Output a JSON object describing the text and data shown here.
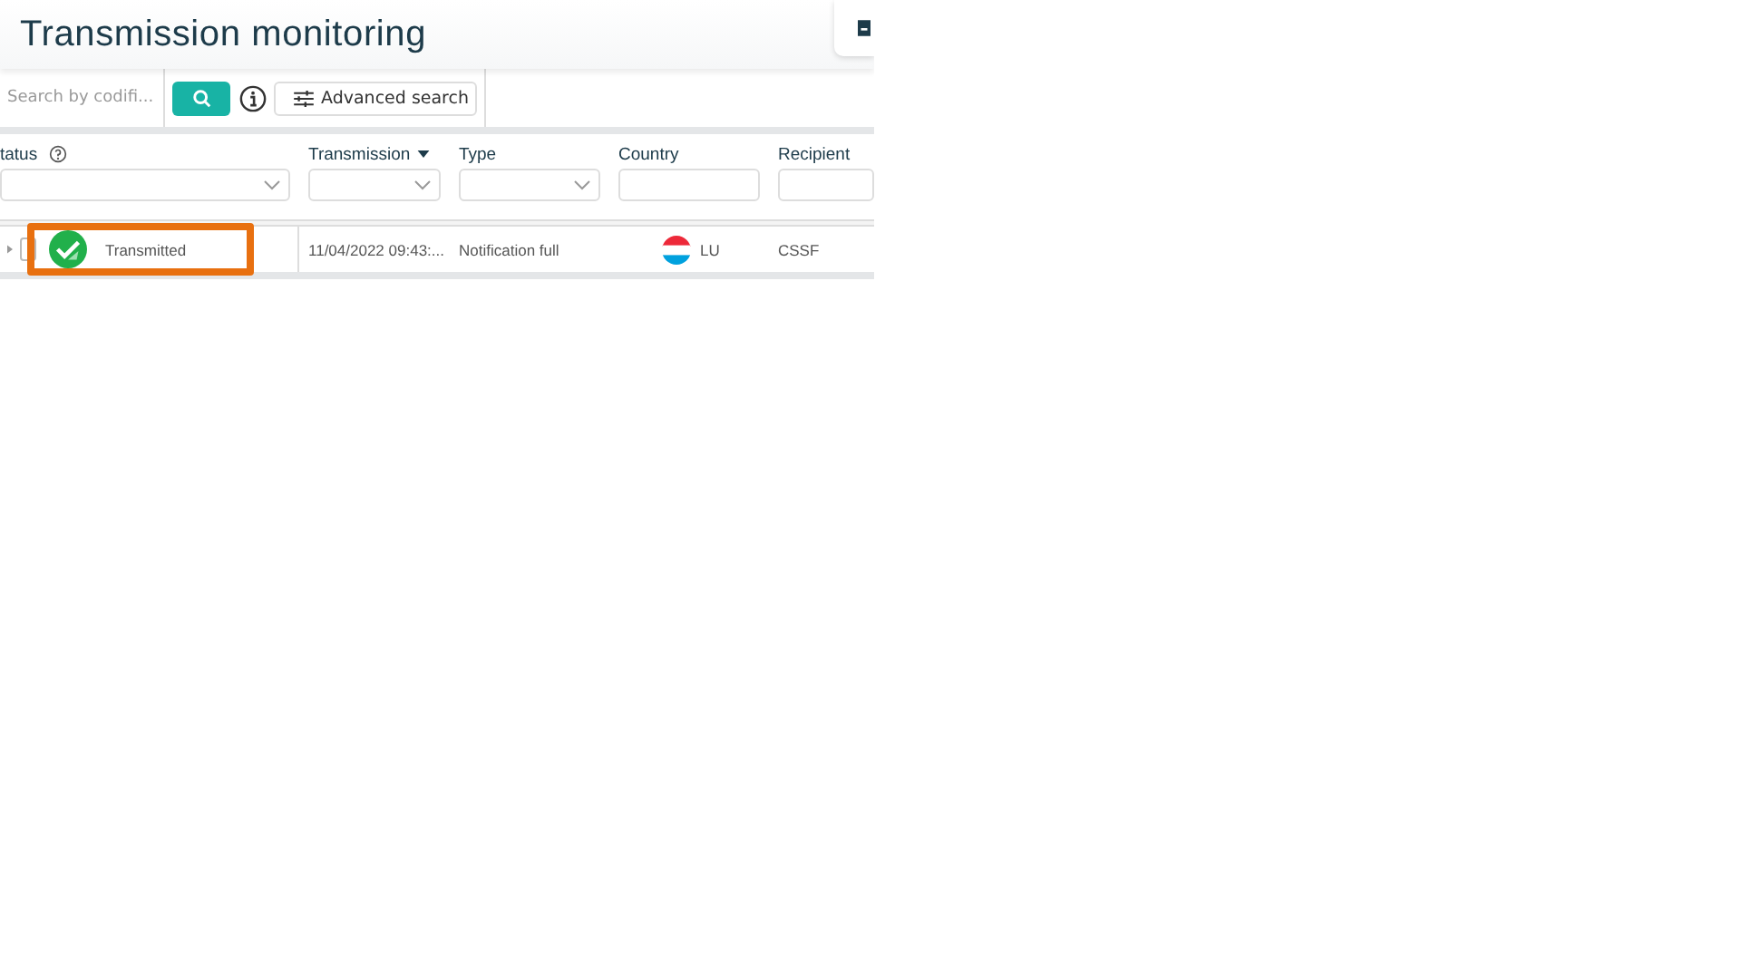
{
  "page": {
    "title": "Transmission monitoring"
  },
  "toolbar": {
    "search": {
      "placeholder": "Search by codifi..."
    },
    "advanced_search": "Advanced search"
  },
  "table": {
    "columns": [
      {
        "label": "tatus",
        "kind": "select",
        "help": true,
        "sorted": false
      },
      {
        "label": "Transmission",
        "kind": "select",
        "help": false,
        "sorted": true
      },
      {
        "label": "Type",
        "kind": "select",
        "help": false,
        "sorted": false
      },
      {
        "label": "Country",
        "kind": "input",
        "help": false,
        "sorted": false
      },
      {
        "label": "Recipient",
        "kind": "input",
        "help": false,
        "sorted": false
      }
    ],
    "rows": [
      {
        "checked": false,
        "highlighted": true,
        "status": "Transmitted",
        "date": "11/04/2022 09:43:...",
        "type": "Notification full",
        "country": "LU",
        "recipient": "CSSF"
      }
    ]
  }
}
